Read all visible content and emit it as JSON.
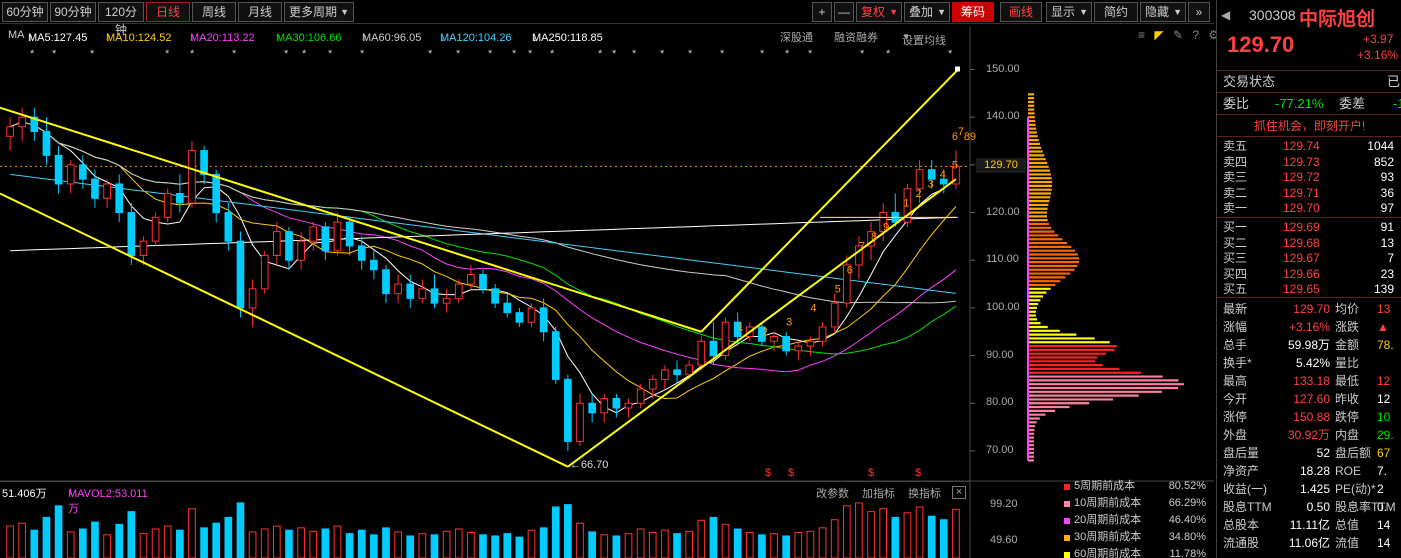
{
  "toolbar": {
    "periods": [
      "60分钟",
      "90分钟",
      "120分钟",
      "日线",
      "周线",
      "月线",
      "更多周期"
    ],
    "active_period": "日线",
    "right_buttons": [
      "+",
      "—",
      "复权",
      "叠加",
      "筹码",
      "画线",
      "显示",
      "简约",
      "隐藏"
    ],
    "nav_icon": "double-chevron-right-icon"
  },
  "ma": {
    "label": "MA",
    "items": [
      {
        "text": "MA5:127.45",
        "arrow": "↑",
        "color": "#ffffff"
      },
      {
        "text": "MA10:124.52",
        "arrow": "↑",
        "color": "#ffcc00"
      },
      {
        "text": "MA20:113.22",
        "arrow": "↑",
        "color": "#ff40ff"
      },
      {
        "text": "MA30:106.66",
        "arrow": "↑",
        "color": "#00e000"
      },
      {
        "text": "MA60:96.05",
        "arrow": "↑",
        "color": "#cccccc"
      },
      {
        "text": "MA120:104.26",
        "arrow": "↓",
        "color": "#40d0ff"
      },
      {
        "text": "MA250:118.85",
        "arrow": "↓",
        "color": "#ffffff"
      }
    ],
    "links": [
      "深股通",
      "融资融券",
      "设置均线"
    ]
  },
  "price_axis": [
    "150.00",
    "140.00",
    "130.00",
    "120.00",
    "110.00",
    "100.00",
    "90.00",
    "80.00",
    "70.00"
  ],
  "current_price_tag": "129.70",
  "low_label": "66.70",
  "wave_labels_first": [
    "1",
    "2",
    "3",
    "4",
    "5",
    "6",
    "7",
    "8",
    "9"
  ],
  "wave_labels_second": [
    "1",
    "2",
    "3",
    "4",
    "5",
    "6",
    "7",
    "8",
    "9"
  ],
  "volume": {
    "text1": "51.406万",
    "text2": "MAVOL2:53.011万",
    "links": [
      "改参数",
      "加指标",
      "换指标"
    ],
    "axis": [
      "99.20",
      "49.60"
    ]
  },
  "cost_legend": [
    {
      "name": "5周期前成本",
      "pct": "80.52%",
      "color": "#ff2020"
    },
    {
      "name": "10周期前成本",
      "pct": "66.29%",
      "color": "#ff80a0"
    },
    {
      "name": "20周期前成本",
      "pct": "46.40%",
      "color": "#ff40ff"
    },
    {
      "name": "30周期前成本",
      "pct": "34.80%",
      "color": "#ffaa00"
    },
    {
      "name": "60周期前成本",
      "pct": "11.78%",
      "color": "#ffff00"
    }
  ],
  "quote": {
    "code": "300308",
    "name": "中际旭创",
    "price": "129.70",
    "change": "+3.97",
    "change_pct": "+3.16%",
    "status_label": "交易状态",
    "status_value": "已",
    "weibi_label": "委比",
    "weibi_value": "-77.21%",
    "weicha_label": "委差",
    "weicha_value": "-1",
    "promo": "抓住机会，即刻开户!",
    "asks": [
      {
        "label": "卖五",
        "price": "129.74",
        "vol": "1044"
      },
      {
        "label": "卖四",
        "price": "129.73",
        "vol": "852"
      },
      {
        "label": "卖三",
        "price": "129.72",
        "vol": "93"
      },
      {
        "label": "卖二",
        "price": "129.71",
        "vol": "36"
      },
      {
        "label": "卖一",
        "price": "129.70",
        "vol": "97"
      }
    ],
    "bids": [
      {
        "label": "买一",
        "price": "129.69",
        "vol": "91"
      },
      {
        "label": "买二",
        "price": "129.68",
        "vol": "13"
      },
      {
        "label": "买三",
        "price": "129.67",
        "vol": "7"
      },
      {
        "label": "买四",
        "price": "129.66",
        "vol": "23"
      },
      {
        "label": "买五",
        "price": "129.65",
        "vol": "139"
      }
    ],
    "stats": [
      {
        "l1": "最新",
        "v1": "129.70",
        "c1": "red",
        "l2": "均价",
        "v2": "13",
        "c2": "red"
      },
      {
        "l1": "涨幅",
        "v1": "+3.16%",
        "c1": "red",
        "l2": "涨跌",
        "v2": "▲",
        "c2": "red"
      },
      {
        "l1": "总手",
        "v1": "59.98万",
        "c1": "white",
        "l2": "金额",
        "v2": "78.",
        "c2": "yellow"
      },
      {
        "l1": "换手*",
        "v1": "5.42%",
        "c1": "white",
        "l2": "量比",
        "v2": "",
        "c2": "white"
      },
      {
        "l1": "最高",
        "v1": "133.18",
        "c1": "red",
        "l2": "最低",
        "v2": "12",
        "c2": "red"
      },
      {
        "l1": "今开",
        "v1": "127.60",
        "c1": "red",
        "l2": "昨收",
        "v2": "12",
        "c2": "white"
      },
      {
        "l1": "涨停",
        "v1": "150.88",
        "c1": "red",
        "l2": "跌停",
        "v2": "10",
        "c2": "green"
      },
      {
        "l1": "外盘",
        "v1": "30.92万",
        "c1": "red",
        "l2": "内盘",
        "v2": "29.",
        "c2": "green"
      },
      {
        "l1": "盘后量",
        "v1": "52",
        "c1": "white",
        "l2": "盘后额",
        "v2": "67",
        "c2": "yellow"
      },
      {
        "l1": "净资产",
        "v1": "18.28",
        "c1": "white",
        "l2": "ROE",
        "v2": "7.",
        "c2": "white"
      },
      {
        "l1": "收益(一)",
        "v1": "1.425",
        "c1": "white",
        "l2": "PE(动)*",
        "v2": "2",
        "c2": "white"
      },
      {
        "l1": "股息TTM",
        "v1": "0.50",
        "c1": "white",
        "l2": "股息率TTM",
        "v2": "0.",
        "c2": "white"
      },
      {
        "l1": "总股本",
        "v1": "11.11亿",
        "c1": "white",
        "l2": "总值",
        "v2": "14",
        "c2": "white"
      },
      {
        "l1": "流通股",
        "v1": "11.06亿",
        "c1": "white",
        "l2": "流值",
        "v2": "14",
        "c2": "white"
      }
    ]
  },
  "chart_data": {
    "type": "candlestick",
    "ylim": [
      66,
      152
    ],
    "candles": [
      [
        136,
        140,
        133,
        138
      ],
      [
        138,
        142,
        135,
        140
      ],
      [
        140,
        142,
        135,
        137
      ],
      [
        137,
        140,
        130,
        132
      ],
      [
        132,
        134,
        124,
        126
      ],
      [
        126,
        131,
        124,
        130
      ],
      [
        130,
        132,
        125,
        127
      ],
      [
        127,
        129,
        121,
        123
      ],
      [
        123,
        127,
        121,
        126
      ],
      [
        126,
        128,
        118,
        120
      ],
      [
        120,
        122,
        109,
        111
      ],
      [
        111,
        115,
        109,
        114
      ],
      [
        114,
        120,
        113,
        119
      ],
      [
        119,
        125,
        118,
        124
      ],
      [
        124,
        128,
        120,
        122
      ],
      [
        122,
        135,
        121,
        133
      ],
      [
        133,
        134,
        126,
        128
      ],
      [
        128,
        129,
        118,
        120
      ],
      [
        120,
        122,
        112,
        114
      ],
      [
        114,
        116,
        98,
        100
      ],
      [
        100,
        106,
        96,
        104
      ],
      [
        104,
        112,
        103,
        111
      ],
      [
        111,
        118,
        109,
        116
      ],
      [
        116,
        117,
        108,
        110
      ],
      [
        110,
        116,
        108,
        114
      ],
      [
        114,
        118,
        112,
        117
      ],
      [
        117,
        118,
        110,
        112
      ],
      [
        112,
        120,
        111,
        118
      ],
      [
        118,
        119,
        111,
        113
      ],
      [
        113,
        115,
        108,
        110
      ],
      [
        110,
        112,
        106,
        108
      ],
      [
        108,
        109,
        101,
        103
      ],
      [
        103,
        107,
        101,
        105
      ],
      [
        105,
        107,
        100,
        102
      ],
      [
        102,
        106,
        101,
        104
      ],
      [
        104,
        107,
        100,
        101
      ],
      [
        101,
        104,
        99,
        102
      ],
      [
        102,
        106,
        101,
        105
      ],
      [
        105,
        109,
        104,
        107
      ],
      [
        107,
        108,
        103,
        104
      ],
      [
        104,
        105,
        100,
        101
      ],
      [
        101,
        103,
        98,
        99
      ],
      [
        99,
        100,
        96,
        97
      ],
      [
        97,
        101,
        96,
        100
      ],
      [
        100,
        102,
        93,
        95
      ],
      [
        95,
        96,
        84,
        85
      ],
      [
        85,
        86,
        70,
        72
      ],
      [
        72,
        82,
        71,
        80
      ],
      [
        80,
        82,
        76,
        78
      ],
      [
        78,
        82,
        76,
        81
      ],
      [
        81,
        82,
        77,
        79
      ],
      [
        79,
        81,
        77,
        80
      ],
      [
        80,
        84,
        79,
        83
      ],
      [
        83,
        86,
        81,
        85
      ],
      [
        85,
        88,
        83,
        87
      ],
      [
        87,
        89,
        84,
        86
      ],
      [
        86,
        89,
        85,
        88
      ],
      [
        88,
        94,
        87,
        93
      ],
      [
        93,
        97,
        88,
        90
      ],
      [
        90,
        98,
        89,
        97
      ],
      [
        97,
        99,
        92,
        94
      ],
      [
        94,
        97,
        93,
        96
      ],
      [
        96,
        97,
        92,
        93
      ],
      [
        93,
        95,
        91,
        94
      ],
      [
        94,
        95,
        90,
        91
      ],
      [
        91,
        93,
        89,
        92
      ],
      [
        92,
        94,
        90,
        93
      ],
      [
        93,
        97,
        92,
        96
      ],
      [
        96,
        103,
        95,
        101
      ],
      [
        101,
        111,
        100,
        109
      ],
      [
        109,
        115,
        106,
        113
      ],
      [
        113,
        118,
        110,
        116
      ],
      [
        116,
        122,
        114,
        120
      ],
      [
        120,
        124,
        117,
        118
      ],
      [
        118,
        126,
        117,
        125
      ],
      [
        125,
        131,
        122,
        129
      ],
      [
        129,
        131,
        125,
        127
      ],
      [
        127,
        129,
        124,
        126
      ],
      [
        126,
        133,
        125,
        129.7
      ]
    ],
    "volumes": [
      55,
      60,
      48,
      70,
      90,
      45,
      50,
      62,
      40,
      58,
      80,
      42,
      50,
      55,
      48,
      85,
      52,
      60,
      70,
      95,
      45,
      50,
      55,
      48,
      52,
      46,
      50,
      55,
      42,
      48,
      40,
      52,
      45,
      38,
      42,
      40,
      46,
      50,
      44,
      40,
      38,
      42,
      36,
      48,
      52,
      88,
      92,
      60,
      45,
      40,
      38,
      42,
      50,
      44,
      48,
      42,
      46,
      65,
      70,
      58,
      50,
      44,
      40,
      42,
      38,
      44,
      46,
      52,
      66,
      90,
      95,
      80,
      85,
      70,
      78,
      88,
      72,
      66,
      84
    ],
    "ma_lines": [
      {
        "name": "MA5",
        "color": "#ffffff"
      },
      {
        "name": "MA10",
        "color": "#ffcc00"
      },
      {
        "name": "MA20",
        "color": "#ff40ff"
      },
      {
        "name": "MA30",
        "color": "#00e000"
      },
      {
        "name": "MA60",
        "color": "#cccccc"
      },
      {
        "name": "MA120",
        "color": "#40d0ff"
      },
      {
        "name": "MA250",
        "color": "#ffffff"
      }
    ]
  }
}
